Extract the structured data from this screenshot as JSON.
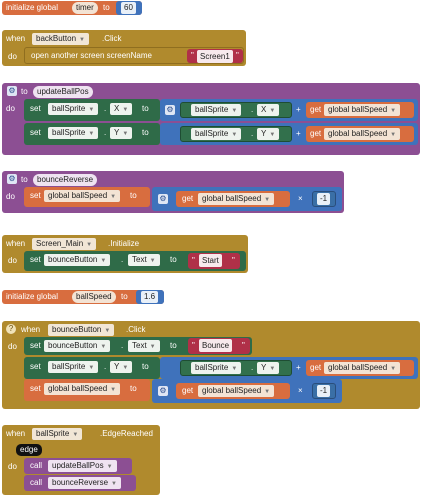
{
  "colors": {
    "variables": "#d86d3f",
    "events": "#b08a2d",
    "procedures": "#8c4f93",
    "components": "#2f6b48",
    "math": "#3f72bb",
    "text": "#b03048"
  },
  "block1": {
    "init": "initialize global",
    "name": "timer",
    "to": "to",
    "value": "60"
  },
  "block2": {
    "when": "when",
    "component": "backButton",
    "event": ".Click",
    "do": "do",
    "action": "open another screen  screenName",
    "q_open": "\"",
    "screen": "Screen1",
    "q_close": "\""
  },
  "block3": {
    "to": "to",
    "proc": "updateBallPos",
    "do": "do",
    "line1": {
      "set": "set",
      "comp": "ballSprite",
      "prop": "X",
      "to": "to",
      "getcomp": "ballSprite",
      "getprop": "X",
      "op": "+",
      "get": "get",
      "var": "global ballSpeed"
    },
    "line2": {
      "set": "set",
      "comp": "ballSprite",
      "prop": "Y",
      "to": "to",
      "getcomp": "ballSprite",
      "getprop": "Y",
      "op": "+",
      "get": "get",
      "var": "global ballSpeed"
    }
  },
  "block4": {
    "to": "to",
    "proc": "bounceReverse",
    "do": "do",
    "set": "set",
    "var": "global ballSpeed",
    "get": "get",
    "getvar": "global ballSpeed",
    "op": "×",
    "num": "-1"
  },
  "block5": {
    "when": "when",
    "component": "Screen_Main",
    "event": ".Initialize",
    "do": "do",
    "set": "set",
    "comp": "bounceButton",
    "prop": "Text",
    "to": "to",
    "q_open": "\"",
    "text": "Start",
    "q_close": "\""
  },
  "block6": {
    "init": "initialize global",
    "name": "ballSpeed",
    "to": "to",
    "value": "1.6"
  },
  "block7": {
    "when": "when",
    "component": "bounceButton",
    "event": ".Click",
    "do": "do",
    "line1": {
      "set": "set",
      "comp": "bounceButton",
      "prop": "Text",
      "to": "to",
      "q_open": "\"",
      "text": "Bounce",
      "q_close": "\""
    },
    "line2": {
      "set": "set",
      "comp": "ballSprite",
      "prop": "Y",
      "to": "to",
      "getcomp": "ballSprite",
      "getprop": "Y",
      "op": "+",
      "get": "get",
      "var": "global ballSpeed"
    },
    "line3": {
      "set": "set",
      "var": "global ballSpeed",
      "to": "to",
      "get": "get",
      "getvar": "global ballSpeed",
      "op": "×",
      "num": "-1"
    }
  },
  "block8": {
    "when": "when",
    "component": "ballSprite",
    "event": ".EdgeReached",
    "param": "edge",
    "do": "do",
    "call1": "call",
    "proc1": "updateBallPos",
    "call2": "call",
    "proc2": "bounceReverse"
  }
}
